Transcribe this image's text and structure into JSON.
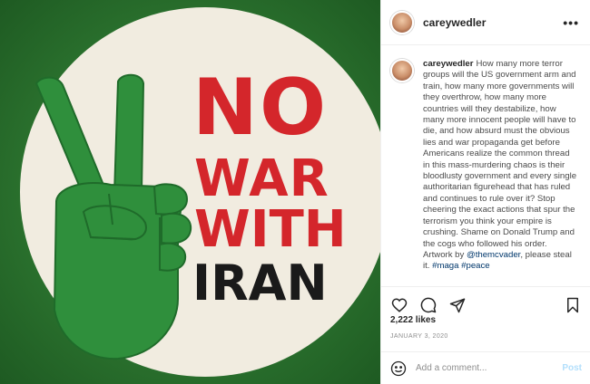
{
  "artwork": {
    "words": [
      "NO",
      "WAR",
      "WITH",
      "IRAN"
    ],
    "colors": {
      "background": "#2f7a32",
      "circle": "#f1ece0",
      "hand": "#2f8f3c",
      "red": "#d4262b",
      "dark": "#1a1a1a"
    }
  },
  "header": {
    "username": "careywedler",
    "more_label": "•••"
  },
  "caption": {
    "username": "careywedler",
    "text": "How many more terror groups will the US government arm and train, how many more governments will they overthrow, how many more countries will they destabilize, how many more innocent people will have to die, and how absurd must the obvious lies and war propaganda get before Americans realize the common thread in this mass-murdering chaos is their bloodlusty government and every single authoritarian figurehead that has ruled and continues to rule over it? Stop cheering the exact actions that spur the terrorism you think your empire is crushing. Shame on Donald Trump and the cogs who followed his order. Artwork by ",
    "mention": "@themcvader",
    "text2": ", please steal it. ",
    "tag1": "#maga",
    "tag2": "#peace"
  },
  "actions": {
    "icons": [
      "heart-icon",
      "comment-icon",
      "share-icon",
      "save-icon"
    ]
  },
  "likes": "2,222 likes",
  "date": "JANUARY 3, 2020",
  "comment": {
    "placeholder": "Add a comment...",
    "post_label": "Post"
  }
}
